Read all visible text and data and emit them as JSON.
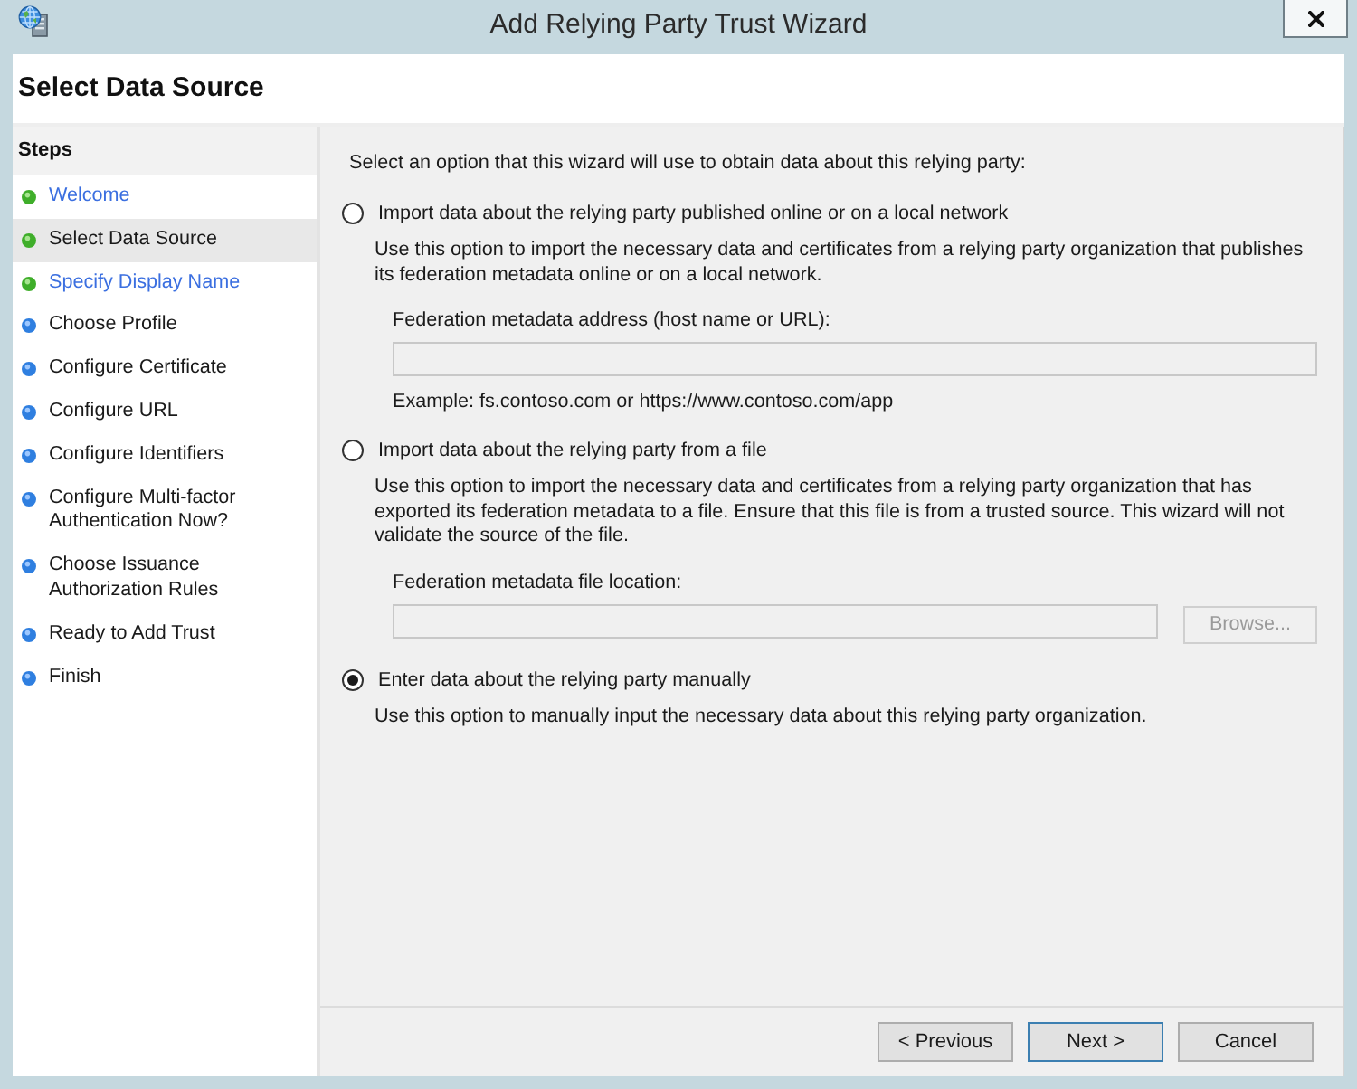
{
  "window": {
    "title": "Add Relying Party Trust Wizard"
  },
  "page": {
    "title": "Select Data Source"
  },
  "steps": {
    "heading": "Steps",
    "items": [
      {
        "label": "Welcome",
        "completed": true,
        "link": true,
        "selected": false
      },
      {
        "label": "Select Data Source",
        "completed": true,
        "link": false,
        "selected": true
      },
      {
        "label": "Specify Display Name",
        "completed": true,
        "link": true,
        "selected": false
      },
      {
        "label": "Choose Profile",
        "completed": false,
        "link": false,
        "selected": false
      },
      {
        "label": "Configure Certificate",
        "completed": false,
        "link": false,
        "selected": false
      },
      {
        "label": "Configure URL",
        "completed": false,
        "link": false,
        "selected": false
      },
      {
        "label": "Configure Identifiers",
        "completed": false,
        "link": false,
        "selected": false
      },
      {
        "label": "Configure Multi-factor Authentication Now?",
        "completed": false,
        "link": false,
        "selected": false
      },
      {
        "label": "Choose Issuance Authorization Rules",
        "completed": false,
        "link": false,
        "selected": false
      },
      {
        "label": "Ready to Add Trust",
        "completed": false,
        "link": false,
        "selected": false
      },
      {
        "label": "Finish",
        "completed": false,
        "link": false,
        "selected": false
      }
    ]
  },
  "content": {
    "prompt": "Select an option that this wizard will use to obtain data about this relying party:",
    "options": [
      {
        "label": "Import data about the relying party published online or on a local network",
        "selected": false,
        "description": "Use this option to import the necessary data and certificates from a relying party organization that publishes its federation metadata online or on a local network.",
        "field": {
          "label": "Federation metadata address (host name or URL):",
          "disabled": true,
          "example": "Example: fs.contoso.com or https://www.contoso.com/app"
        }
      },
      {
        "label": "Import data about the relying party from a file",
        "selected": false,
        "description": "Use this option to import the necessary data and certificates from a relying party organization that has exported its federation metadata to a file. Ensure that this file is from a trusted source. This wizard will not validate the source of the file.",
        "field": {
          "label": "Federation metadata file location:",
          "disabled": true,
          "browse": {
            "label": "Browse...",
            "disabled": true
          }
        }
      },
      {
        "label": "Enter data about the relying party manually",
        "selected": true,
        "description": "Use this option to manually input the necessary data about this relying party organization."
      }
    ]
  },
  "buttons": [
    {
      "label": "< Previous",
      "default": false
    },
    {
      "label": "Next >",
      "default": true
    },
    {
      "label": "Cancel",
      "default": false
    }
  ]
}
